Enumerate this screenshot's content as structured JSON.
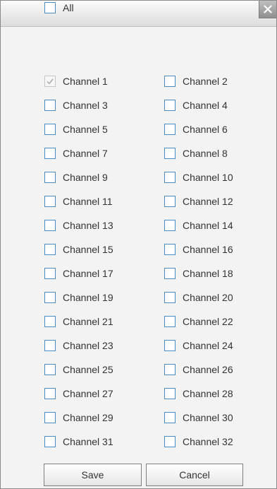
{
  "dialog": {
    "close_icon": "close-icon",
    "all_label": "All",
    "all_checked": false,
    "channels": [
      {
        "label": "Channel 1",
        "checked": true,
        "disabled": true
      },
      {
        "label": "Channel 2",
        "checked": false
      },
      {
        "label": "Channel 3",
        "checked": false
      },
      {
        "label": "Channel 4",
        "checked": false
      },
      {
        "label": "Channel 5",
        "checked": false
      },
      {
        "label": "Channel 6",
        "checked": false
      },
      {
        "label": "Channel 7",
        "checked": false
      },
      {
        "label": "Channel 8",
        "checked": false
      },
      {
        "label": "Channel 9",
        "checked": false
      },
      {
        "label": "Channel 10",
        "checked": false
      },
      {
        "label": "Channel 11",
        "checked": false
      },
      {
        "label": "Channel 12",
        "checked": false
      },
      {
        "label": "Channel 13",
        "checked": false
      },
      {
        "label": "Channel 14",
        "checked": false
      },
      {
        "label": "Channel 15",
        "checked": false
      },
      {
        "label": "Channel 16",
        "checked": false
      },
      {
        "label": "Channel 17",
        "checked": false
      },
      {
        "label": "Channel 18",
        "checked": false
      },
      {
        "label": "Channel 19",
        "checked": false
      },
      {
        "label": "Channel 20",
        "checked": false
      },
      {
        "label": "Channel 21",
        "checked": false
      },
      {
        "label": "Channel 22",
        "checked": false
      },
      {
        "label": "Channel 23",
        "checked": false
      },
      {
        "label": "Channel 24",
        "checked": false
      },
      {
        "label": "Channel 25",
        "checked": false
      },
      {
        "label": "Channel 26",
        "checked": false
      },
      {
        "label": "Channel 27",
        "checked": false
      },
      {
        "label": "Channel 28",
        "checked": false
      },
      {
        "label": "Channel 29",
        "checked": false
      },
      {
        "label": "Channel 30",
        "checked": false
      },
      {
        "label": "Channel 31",
        "checked": false
      },
      {
        "label": "Channel 32",
        "checked": false
      }
    ],
    "save_label": "Save",
    "cancel_label": "Cancel",
    "colors": {
      "checkbox_border": "#4a8bc2",
      "dialog_bg": "#f3f3f3",
      "checkmark_disabled": "#b4b4b4"
    }
  }
}
